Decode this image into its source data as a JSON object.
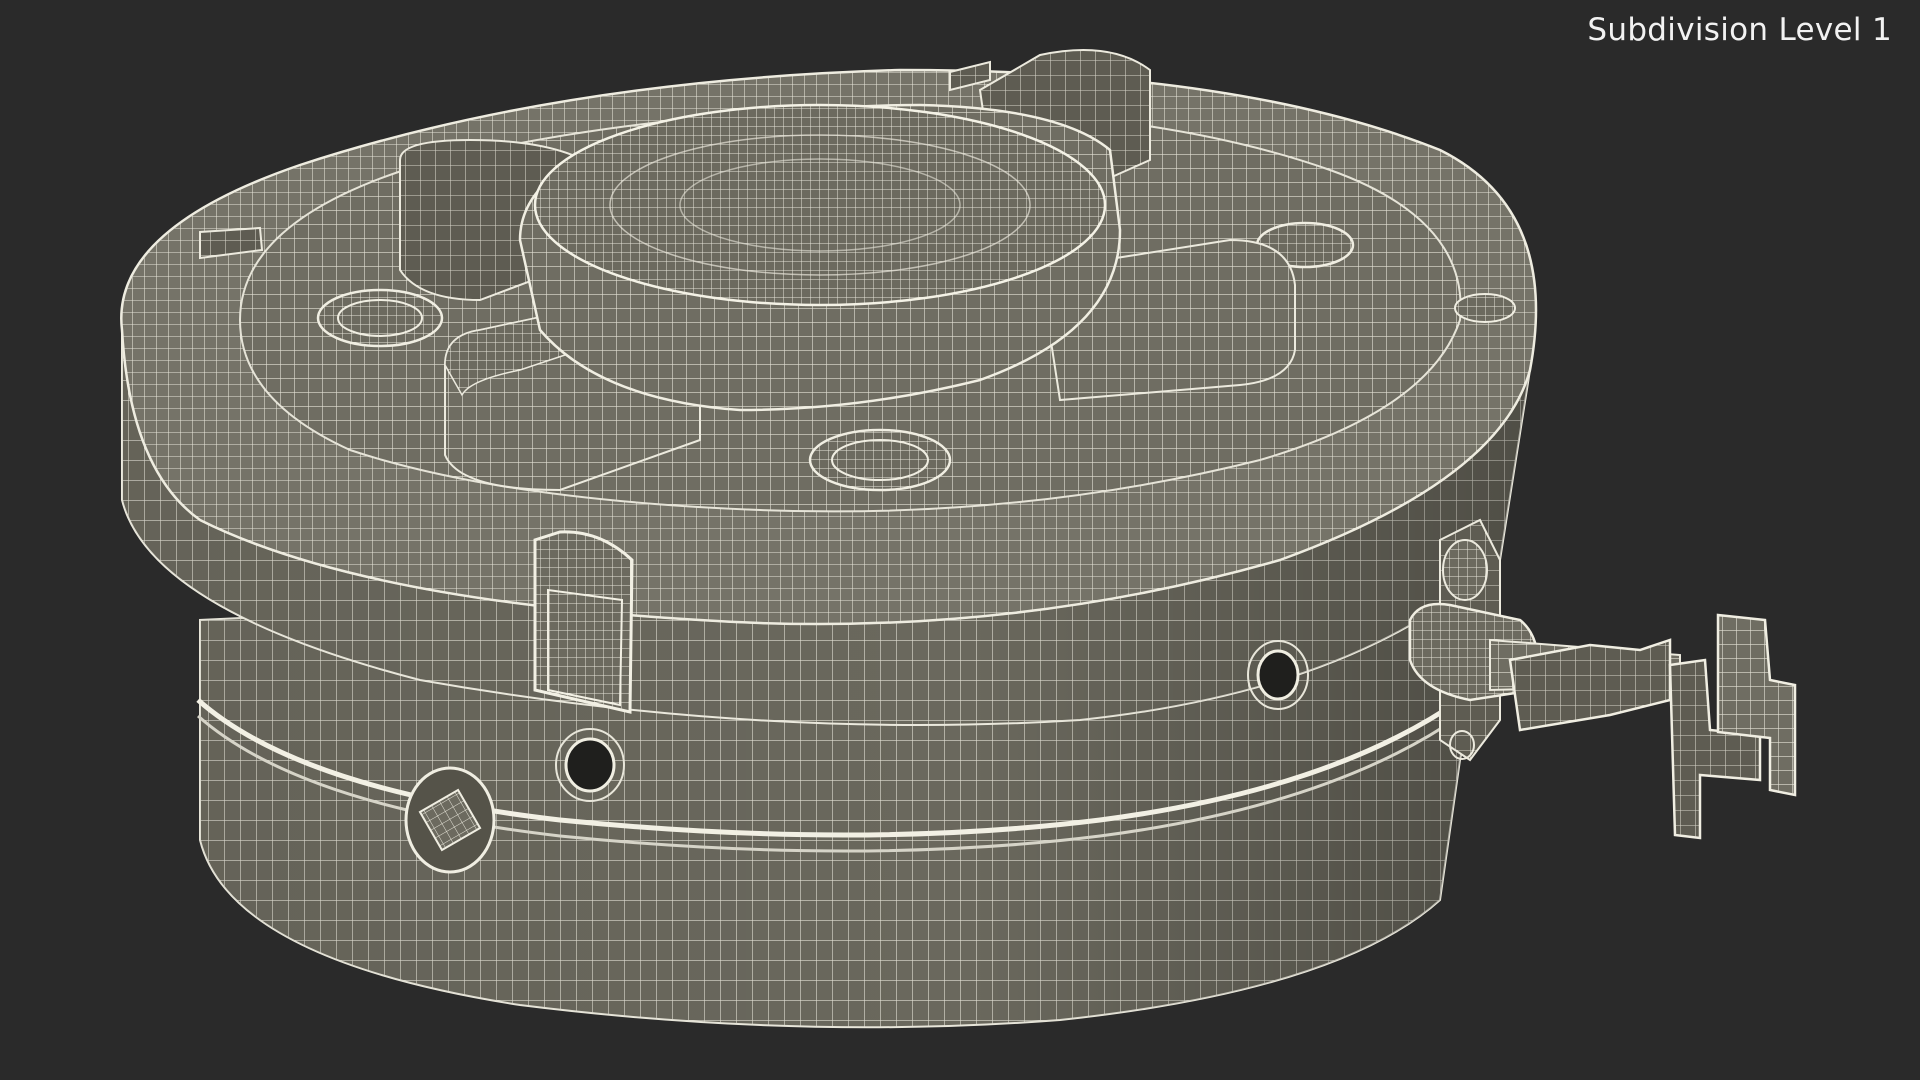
{
  "overlay": {
    "subdivision_label": "Subdivision Level 1"
  },
  "scene": {
    "object": "cylindrical-mine-wireframe-model",
    "background_color": "#2a2a2a",
    "surface_color": "#6f6d62",
    "wire_color": "#e8e6da"
  }
}
